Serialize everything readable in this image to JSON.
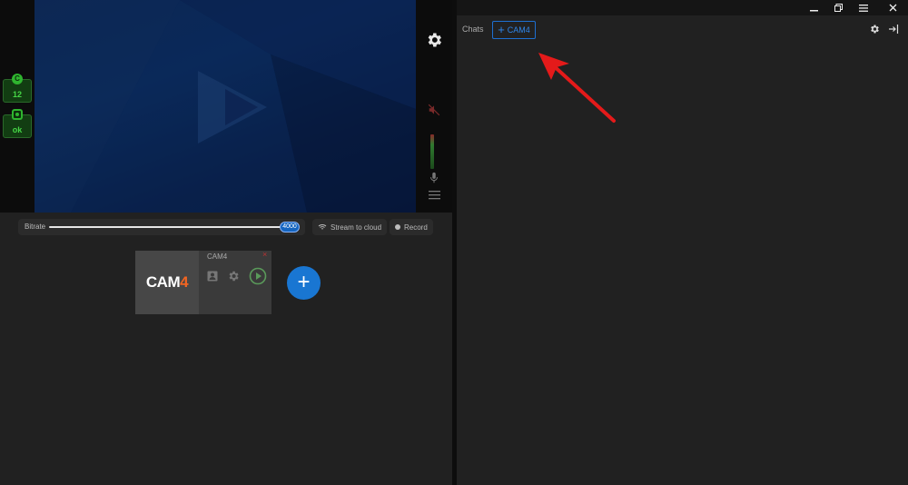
{
  "status": {
    "credits_icon": "C",
    "credits_value": "12",
    "health_value": "ok"
  },
  "controls": {
    "bitrate_label": "Bitrate",
    "bitrate_value": "4000",
    "bitrate_fraction": 1.0,
    "stream_to_cloud": "Stream to cloud",
    "record": "Record"
  },
  "stream_card": {
    "logo_part1": "CAM",
    "logo_part2": "4",
    "title": "CAM4",
    "close": "×"
  },
  "add_stream": "+",
  "chats": {
    "label": "Chats",
    "add_chat_label": "CAM4",
    "add_chat_plus": "+"
  },
  "window_controls": [
    "minimize",
    "restore",
    "menu",
    "close"
  ],
  "icons": [
    "gear-icon",
    "mute-icon",
    "mic-icon",
    "menu-icon",
    "wifi-icon",
    "settings-icon",
    "exit-icon",
    "play-icon",
    "contact-icon"
  ],
  "colors": {
    "accent": "#1976d2",
    "status_green": "#46d646",
    "brand_orange": "#f26522",
    "annotation_red": "#e41a1a"
  }
}
